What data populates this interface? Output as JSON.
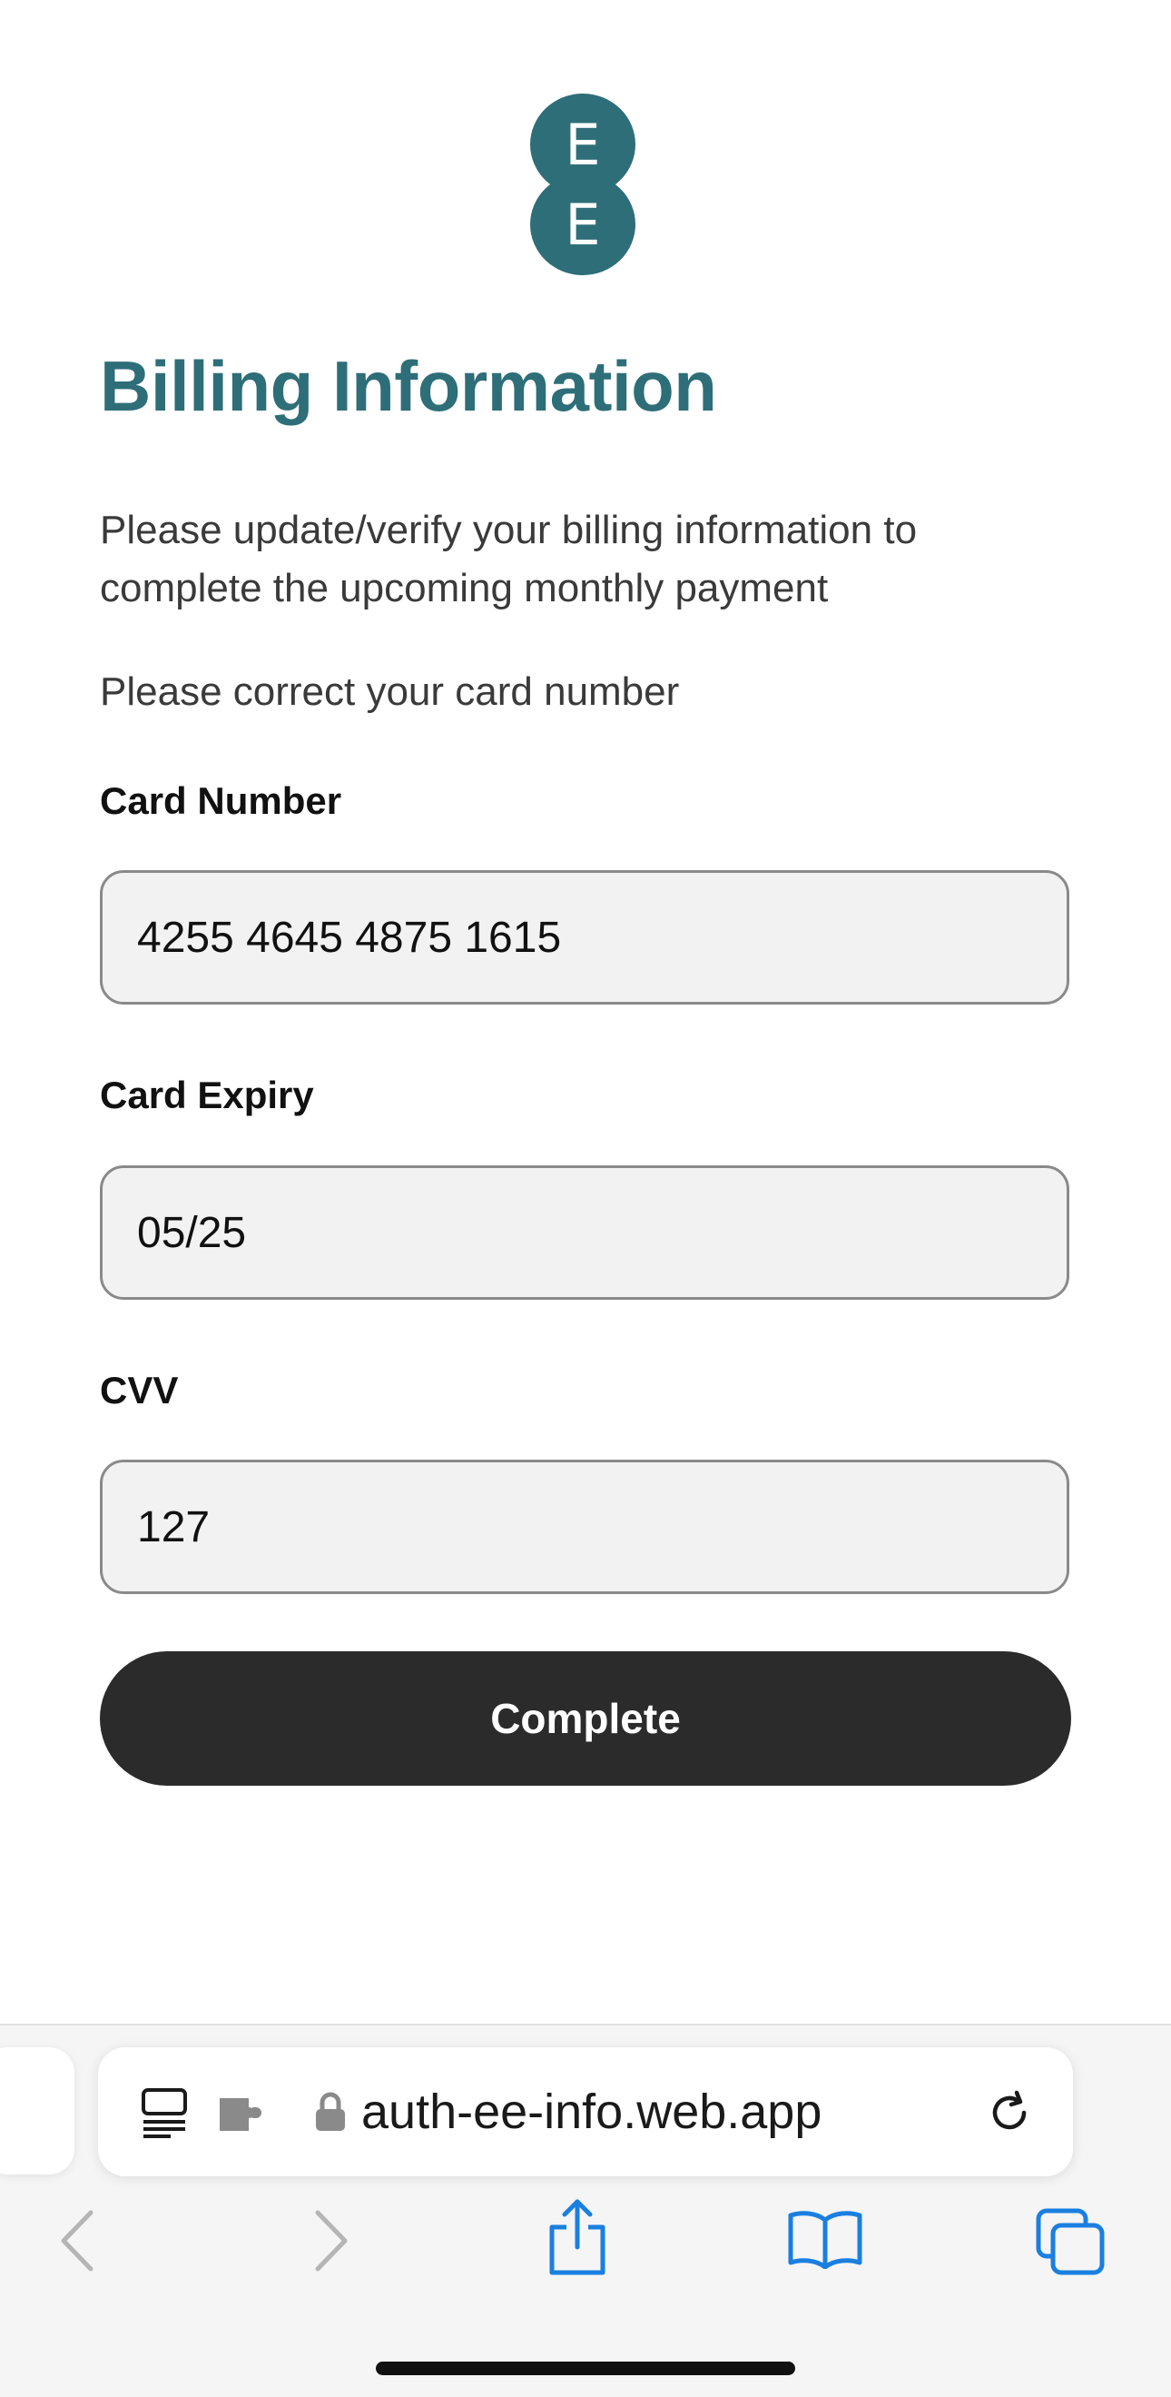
{
  "brand": {
    "logo_letters": [
      "E",
      "E"
    ],
    "color": "#2e6e78"
  },
  "page": {
    "title": "Billing Information",
    "intro": "Please update/verify your billing information to complete the upcoming monthly payment",
    "notice": "Please correct your card number"
  },
  "form": {
    "card_number": {
      "label": "Card Number",
      "value": "4255 4645 4875 1615"
    },
    "card_expiry": {
      "label": "Card Expiry",
      "value": "05/25"
    },
    "cvv": {
      "label": "CVV",
      "value": "127"
    },
    "submit_label": "Complete"
  },
  "browser": {
    "url": "auth-ee-info.web.app",
    "icons": [
      "reader-icon",
      "extension-icon",
      "lock-icon",
      "reload-icon",
      "back-icon",
      "forward-icon",
      "share-icon",
      "bookmarks-icon",
      "tabs-icon"
    ],
    "accent": "#1a7fe0"
  }
}
